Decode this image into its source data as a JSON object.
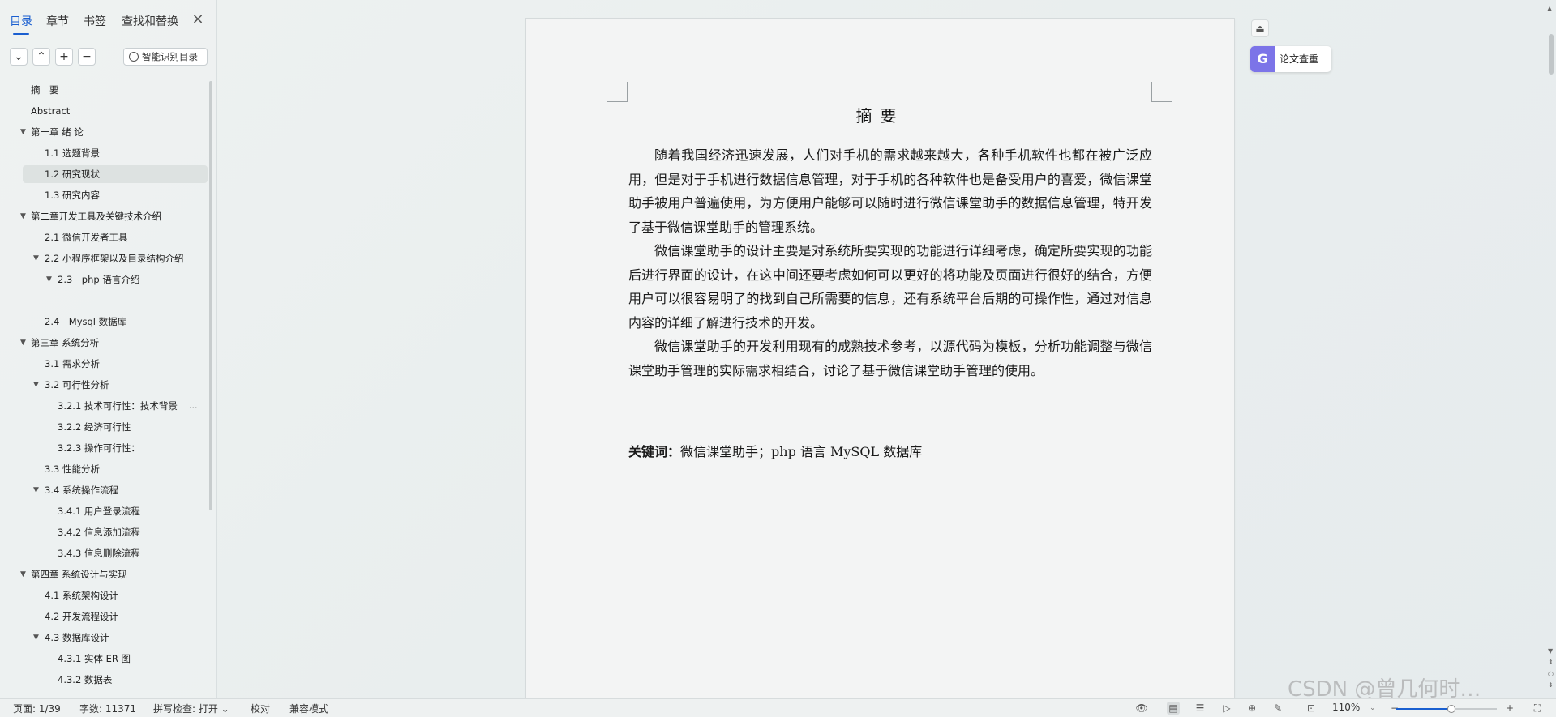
{
  "nav": {
    "tabs": [
      {
        "label": "目录",
        "active": true
      },
      {
        "label": "章节",
        "active": false
      },
      {
        "label": "书签",
        "active": false
      },
      {
        "label": "查找和替换",
        "active": false
      }
    ],
    "close_glyph": "×",
    "toolbar": {
      "expand_glyph": "⌄",
      "collapse_glyph": "⌃",
      "add_glyph": "+",
      "remove_glyph": "−",
      "smart_label": "智能识别目录"
    },
    "outline": [
      {
        "label": "摘　要",
        "level": 1,
        "expander": "",
        "selected": false
      },
      {
        "label": "Abstract",
        "level": 1,
        "expander": "",
        "selected": false
      },
      {
        "label": "第一章 绪 论",
        "level": 1,
        "expander": "▼",
        "selected": false
      },
      {
        "label": "1.1 选题背景",
        "level": 2,
        "expander": "",
        "selected": false
      },
      {
        "label": "1.2 研究现状",
        "level": 2,
        "expander": "",
        "selected": true
      },
      {
        "label": "1.3 研究内容",
        "level": 2,
        "expander": "",
        "selected": false
      },
      {
        "label": "第二章开发工具及关键技术介绍",
        "level": 1,
        "expander": "▼",
        "selected": false
      },
      {
        "label": "2.1 微信开发者工具",
        "level": 2,
        "expander": "",
        "selected": false
      },
      {
        "label": "2.2 小程序框架以及目录结构介绍",
        "level": 2,
        "expander": "▼",
        "selected": false
      },
      {
        "label": "2.3　php 语言介绍",
        "level": 3,
        "expander": "▼",
        "selected": false
      },
      {
        "label": "",
        "level": 3,
        "expander": "",
        "selected": false
      },
      {
        "label": "2.4　Mysql 数据库",
        "level": 2,
        "expander": "",
        "selected": false
      },
      {
        "label": "第三章  系统分析",
        "level": 1,
        "expander": "▼",
        "selected": false
      },
      {
        "label": "3.1 需求分析",
        "level": 2,
        "expander": "",
        "selected": false
      },
      {
        "label": "3.2 可行性分析",
        "level": 2,
        "expander": "▼",
        "selected": false
      },
      {
        "label": "3.2.1 技术可行性：技术背景",
        "level": 3,
        "expander": "",
        "selected": false,
        "more": "..."
      },
      {
        "label": "3.2.2 经济可行性",
        "level": 3,
        "expander": "",
        "selected": false
      },
      {
        "label": "3.2.3 操作可行性：",
        "level": 3,
        "expander": "",
        "selected": false
      },
      {
        "label": "3.3 性能分析",
        "level": 2,
        "expander": "",
        "selected": false
      },
      {
        "label": "3.4 系统操作流程",
        "level": 2,
        "expander": "▼",
        "selected": false
      },
      {
        "label": "3.4.1 用户登录流程",
        "level": 3,
        "expander": "",
        "selected": false
      },
      {
        "label": "3.4.2 信息添加流程",
        "level": 3,
        "expander": "",
        "selected": false
      },
      {
        "label": "3.4.3 信息删除流程",
        "level": 3,
        "expander": "",
        "selected": false
      },
      {
        "label": "第四章  系统设计与实现",
        "level": 1,
        "expander": "▼",
        "selected": false
      },
      {
        "label": "4.1 系统架构设计",
        "level": 2,
        "expander": "",
        "selected": false
      },
      {
        "label": "4.2 开发流程设计",
        "level": 2,
        "expander": "",
        "selected": false
      },
      {
        "label": "4.3 数据库设计",
        "level": 2,
        "expander": "▼",
        "selected": false
      },
      {
        "label": "4.3.1 实体 ER 图",
        "level": 3,
        "expander": "",
        "selected": false
      },
      {
        "label": "4.3.2 数据表",
        "level": 3,
        "expander": "",
        "selected": false
      }
    ]
  },
  "document": {
    "title": "摘要",
    "paragraphs": [
      "随着我国经济迅速发展，人们对手机的需求越来越大，各种手机软件也都在被广泛应用，但是对于手机进行数据信息管理，对于手机的各种软件也是备受用户的喜爱，微信课堂助手被用户普遍使用，为方便用户能够可以随时进行微信课堂助手的数据信息管理，特开发了基于微信课堂助手的管理系统。",
      "微信课堂助手的设计主要是对系统所要实现的功能进行详细考虑，确定所要实现的功能后进行界面的设计，在这中间还要考虑如何可以更好的将功能及页面进行很好的结合，方便用户可以很容易明了的找到自己所需要的信息，还有系统平台后期的可操作性，通过对信息内容的详细了解进行技术的开发。",
      "微信课堂助手的开发利用现有的成熟技术参考，以源代码为模板，分析功能调整与微信课堂助手管理的实际需求相结合，讨论了基于微信课堂助手管理的使用。"
    ],
    "keywords_label": "关键词：",
    "keywords_value": "微信课堂助手；php 语言 MySQL 数据库"
  },
  "right_tools": {
    "collapse_glyph": "⏏",
    "check_logo": "G",
    "check_label": "论文查重"
  },
  "status": {
    "page": "页面: 1/39",
    "words": "字数: 11371",
    "spell": "拼写检查: 打开 ⌄",
    "proof": "校对",
    "compat": "兼容模式",
    "zoom": "110%",
    "zoom_fraction": 0.55,
    "icons": {
      "eye": "👁",
      "page_view": "▤",
      "outline_view": "☰",
      "play": "▷",
      "web": "⊕",
      "pen": "✎",
      "fit": "⊡",
      "zoom_minus": "−",
      "zoom_plus": "+",
      "fullscreen": "⛶"
    }
  },
  "watermark": "CSDN @曾几何时…",
  "colors": {
    "accent": "#1a5fd0",
    "check_logo_bg": "#7c74e8",
    "selected_row": "#dde2e1",
    "page_bg": "#f3f4f4"
  }
}
